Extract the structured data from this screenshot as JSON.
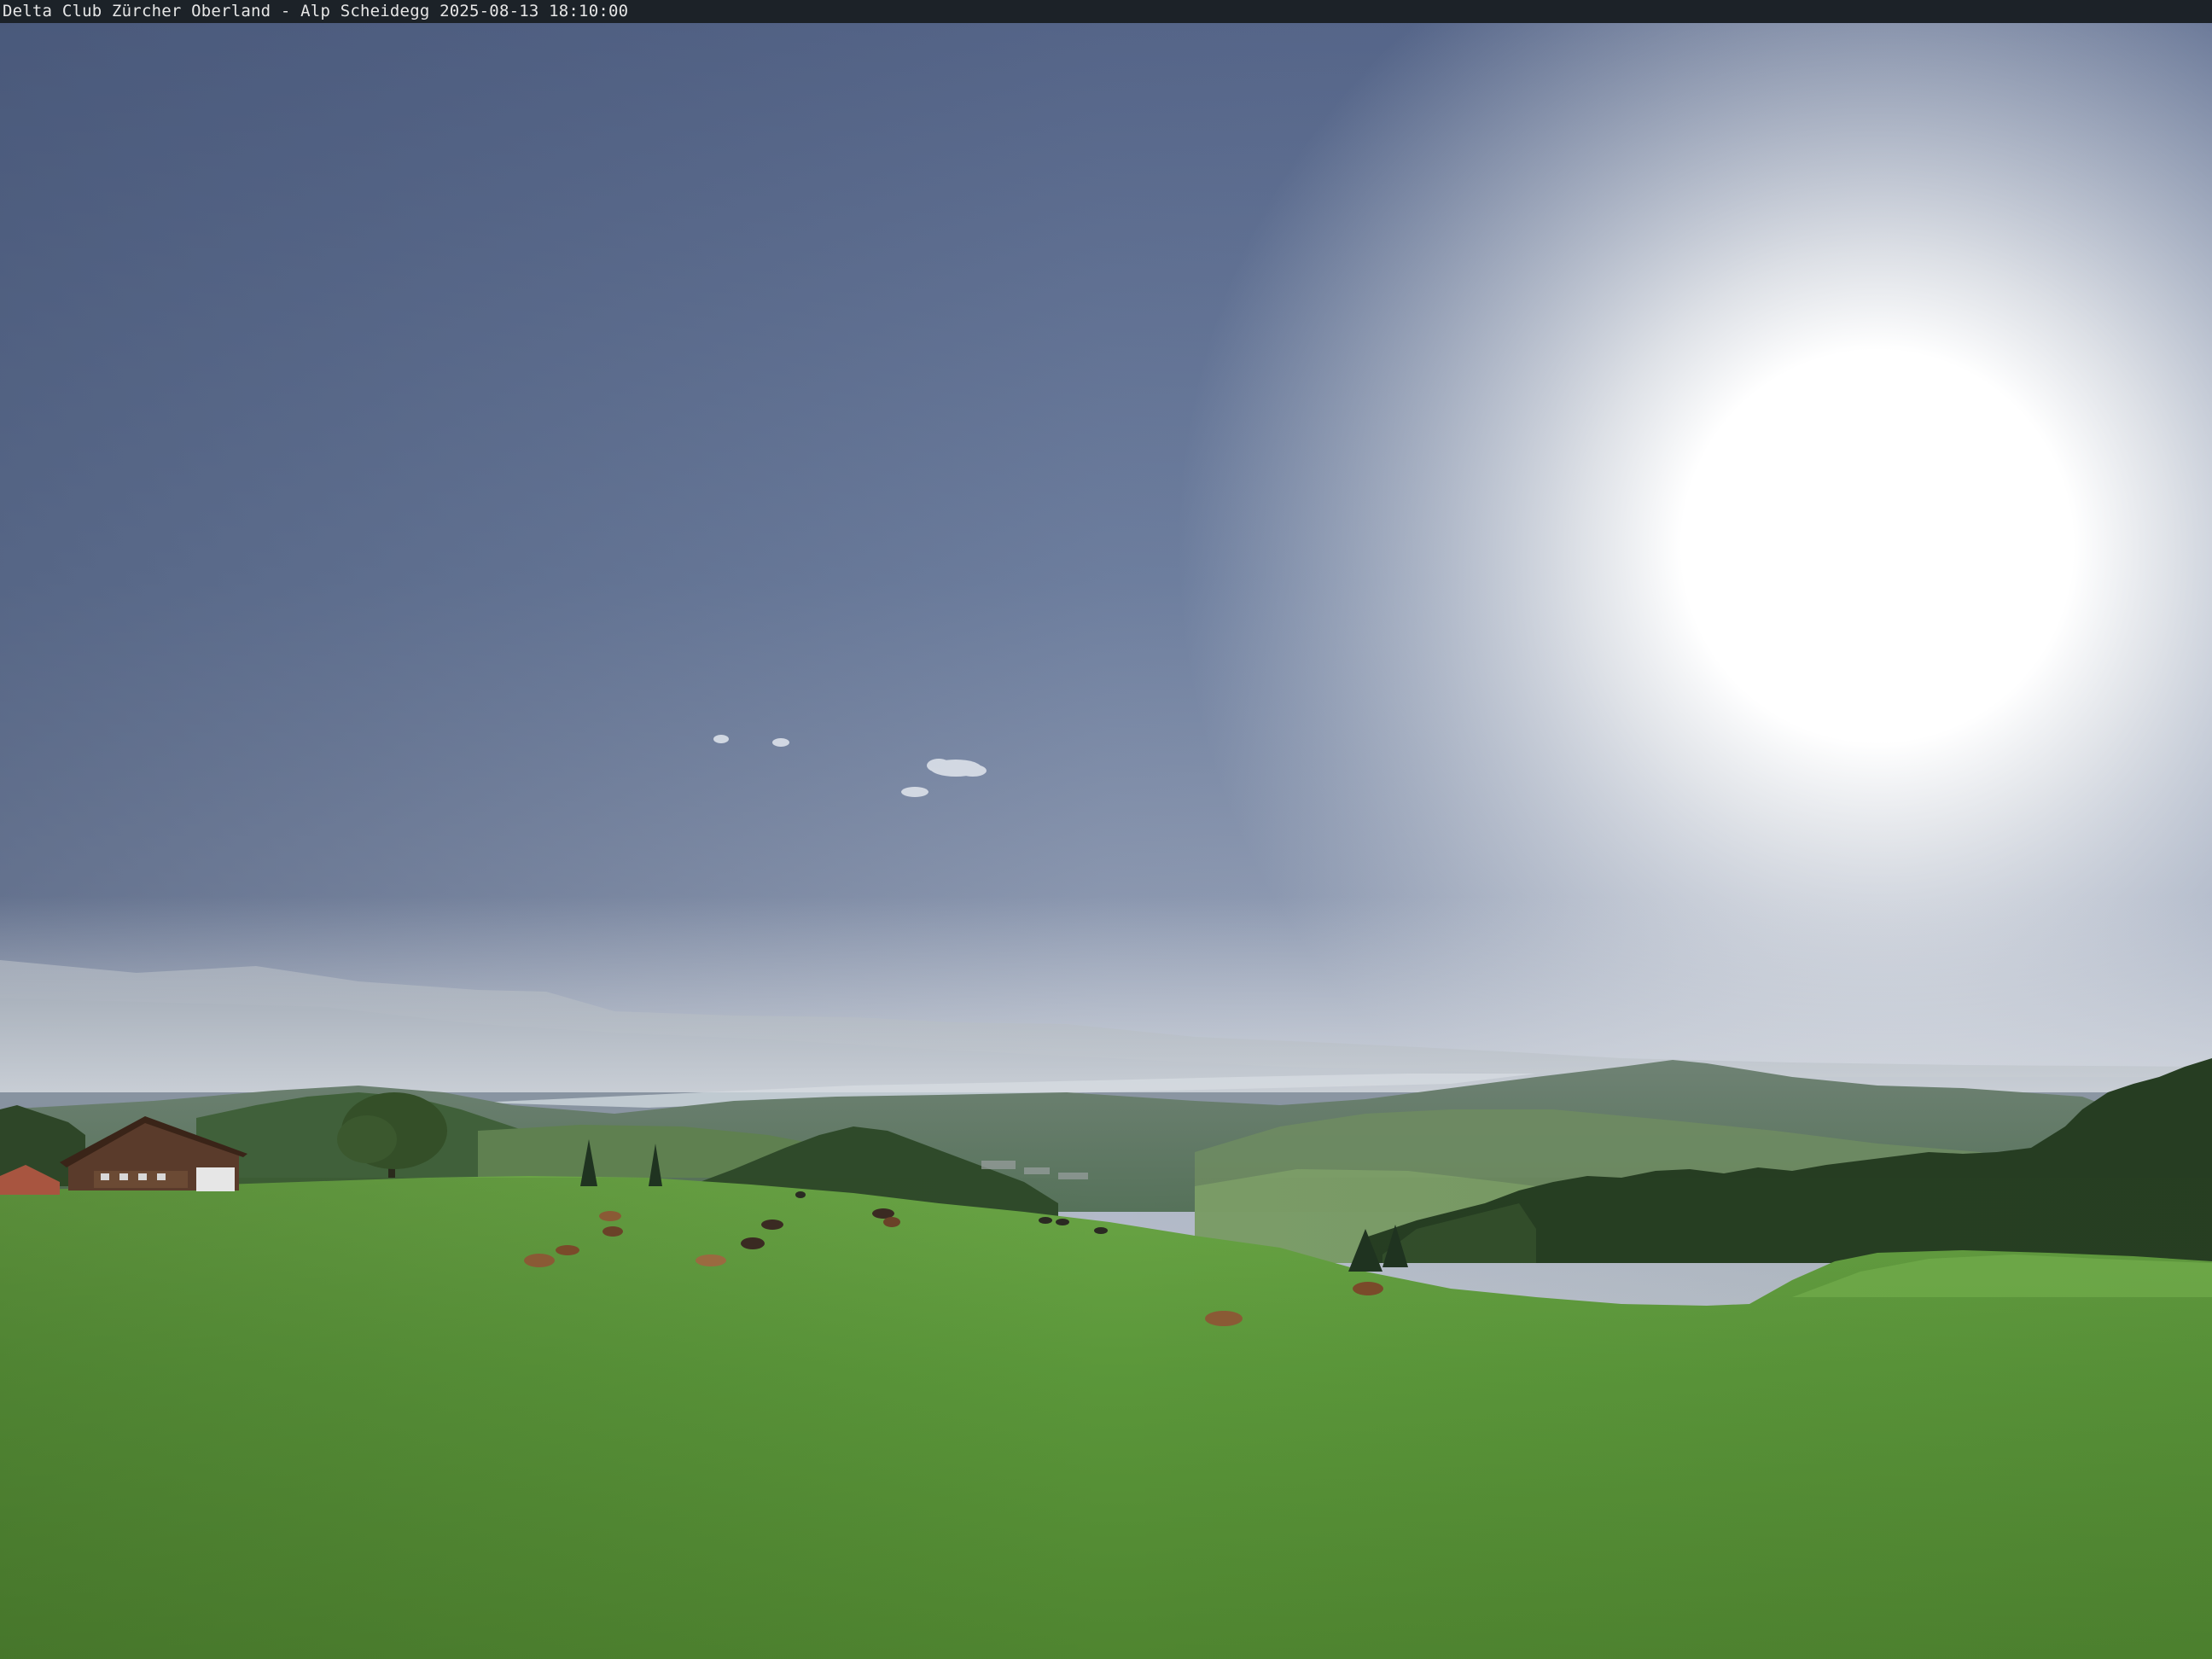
{
  "caption": {
    "text": "Delta Club Zürcher Oberland - Alp Scheidegg 2025-08-13 18:10:00"
  },
  "colors": {
    "sky_top": "#5b6b8c",
    "sky_horizon": "#d7dbe0",
    "sun_glow": "#ffffff",
    "meadow": "#5f9a3a",
    "forest": "#2f4a28",
    "distant_hills": "#8f9aa8",
    "lake": "#c9d1d8",
    "caption_bar": "#1c2228",
    "caption_text": "#e6e6e6"
  }
}
